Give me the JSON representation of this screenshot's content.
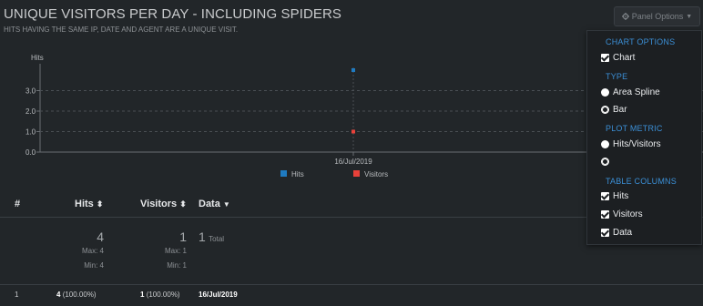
{
  "header": {
    "title": "UNIQUE VISITORS PER DAY - INCLUDING SPIDERS",
    "subtitle": "HITS HAVING THE SAME IP, DATE AND AGENT ARE A UNIQUE VISIT."
  },
  "panel_button": {
    "label": "Panel Options",
    "icon": "gear-icon"
  },
  "chart_data": {
    "type": "area",
    "y_axis_label": "Hits",
    "y_ticks": [
      "0.0",
      "1.0",
      "2.0",
      "3.0"
    ],
    "ylim": [
      0,
      4
    ],
    "categories": [
      "16/Jul/2019"
    ],
    "series": [
      {
        "name": "Hits",
        "values": [
          4
        ],
        "color": "#1f7bc1"
      },
      {
        "name": "Visitors",
        "values": [
          1
        ],
        "color": "#e8413a"
      }
    ],
    "legend": "bottom-center",
    "grid": true
  },
  "table": {
    "headers": {
      "index": "#",
      "hits": "Hits",
      "visitors": "Visitors",
      "data": "Data"
    },
    "summary": {
      "hits_total": "4",
      "hits_max": "Max: 4",
      "hits_min": "Min: 4",
      "visitors_total": "1",
      "visitors_max": "Max: 1",
      "visitors_min": "Min: 1",
      "data_total": "1",
      "data_total_label": "Total"
    },
    "rows": [
      {
        "index": "1",
        "hits": "4",
        "hits_pct": "(100.00%)",
        "visitors": "1",
        "visitors_pct": "(100.00%)",
        "data": "16/Jul/2019"
      }
    ]
  },
  "dropdown": {
    "chart_options_header": "CHART OPTIONS",
    "chart_label": "Chart",
    "type_header": "TYPE",
    "area_spline_label": "Area Spline",
    "bar_label": "Bar",
    "plot_metric_header": "PLOT METRIC",
    "hits_visitors_label": "Hits/Visitors",
    "empty_metric_label": "",
    "table_columns_header": "TABLE COLUMNS",
    "col_hits_label": "Hits",
    "col_visitors_label": "Visitors",
    "col_data_label": "Data"
  },
  "colors": {
    "accent": "#3b8fd6",
    "background": "#222629",
    "hits": "#1f7bc1",
    "visitors": "#e8413a"
  }
}
